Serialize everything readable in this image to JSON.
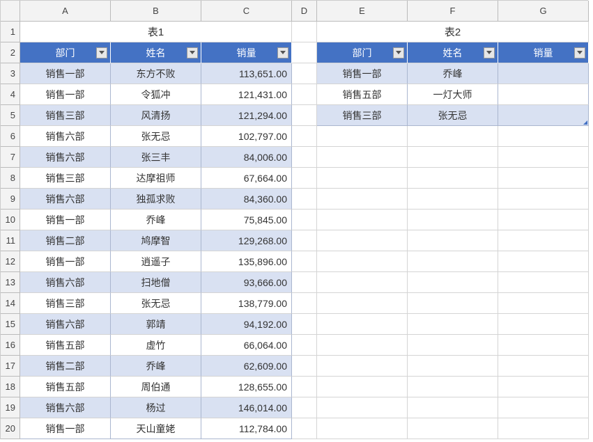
{
  "columns": [
    "A",
    "B",
    "C",
    "D",
    "E",
    "F",
    "G"
  ],
  "row_numbers": [
    1,
    2,
    3,
    4,
    5,
    6,
    7,
    8,
    9,
    10,
    11,
    12,
    13,
    14,
    15,
    16,
    17,
    18,
    19,
    20
  ],
  "table1": {
    "title": "表1",
    "headers": [
      "部门",
      "姓名",
      "销量"
    ],
    "rows": [
      [
        "销售一部",
        "东方不败",
        "113,651.00"
      ],
      [
        "销售一部",
        "令狐冲",
        "121,431.00"
      ],
      [
        "销售三部",
        "风清扬",
        "121,294.00"
      ],
      [
        "销售六部",
        "张无忌",
        "102,797.00"
      ],
      [
        "销售六部",
        "张三丰",
        "84,006.00"
      ],
      [
        "销售三部",
        "达摩祖师",
        "67,664.00"
      ],
      [
        "销售六部",
        "独孤求败",
        "84,360.00"
      ],
      [
        "销售一部",
        "乔峰",
        "75,845.00"
      ],
      [
        "销售二部",
        "鸠摩智",
        "129,268.00"
      ],
      [
        "销售一部",
        "逍遥子",
        "135,896.00"
      ],
      [
        "销售六部",
        "扫地僧",
        "93,666.00"
      ],
      [
        "销售三部",
        "张无忌",
        "138,779.00"
      ],
      [
        "销售六部",
        "郭靖",
        "94,192.00"
      ],
      [
        "销售五部",
        "虚竹",
        "66,064.00"
      ],
      [
        "销售二部",
        "乔峰",
        "62,609.00"
      ],
      [
        "销售五部",
        "周伯通",
        "128,655.00"
      ],
      [
        "销售六部",
        "杨过",
        "146,014.00"
      ],
      [
        "销售一部",
        "天山童姥",
        "112,784.00"
      ]
    ]
  },
  "table2": {
    "title": "表2",
    "headers": [
      "部门",
      "姓名",
      "销量"
    ],
    "rows": [
      [
        "销售一部",
        "乔峰",
        ""
      ],
      [
        "销售五部",
        "一灯大师",
        ""
      ],
      [
        "销售三部",
        "张无忌",
        ""
      ]
    ]
  }
}
